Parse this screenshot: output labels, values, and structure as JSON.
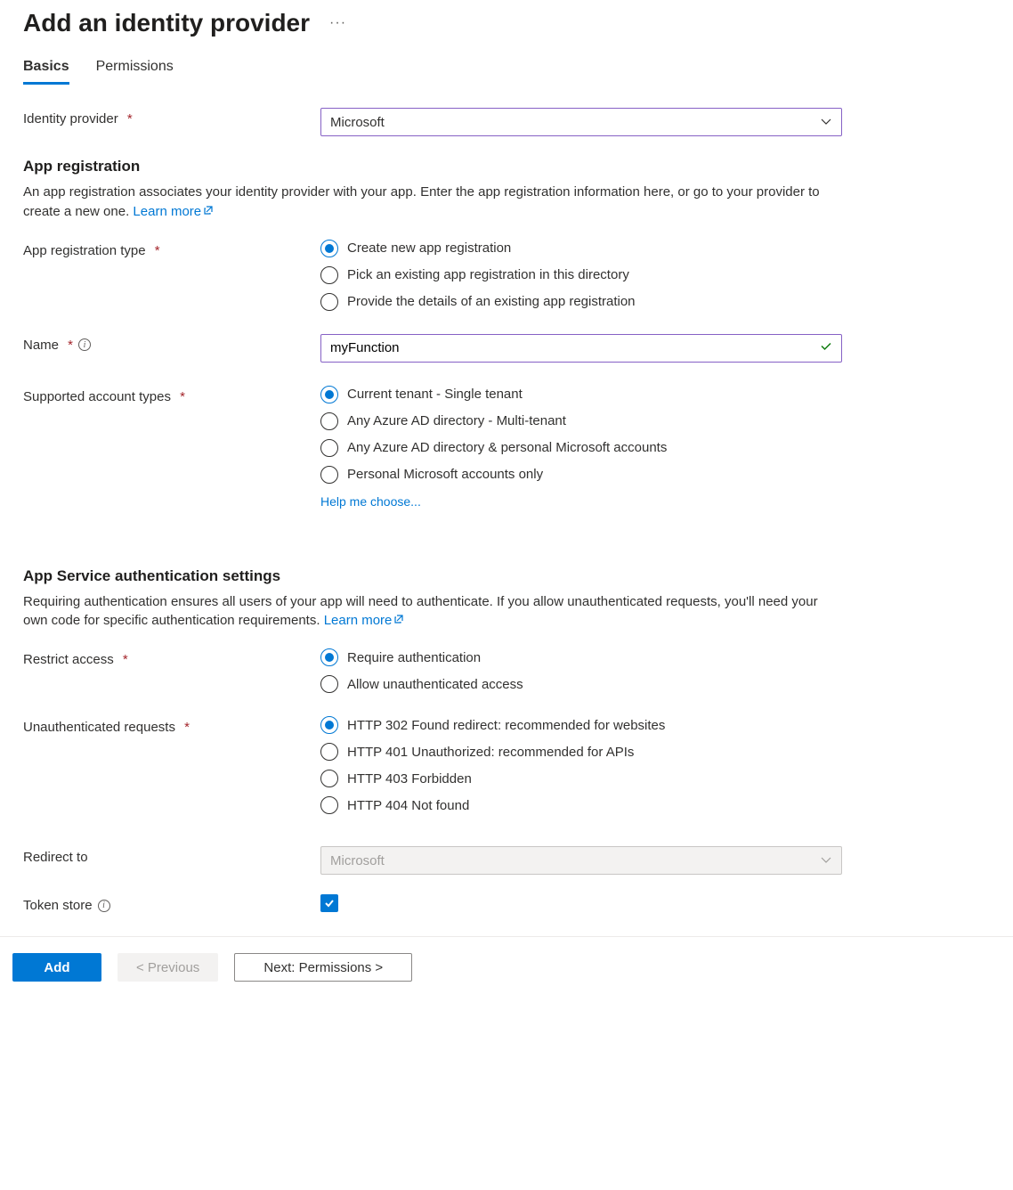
{
  "header": {
    "title": "Add an identity provider"
  },
  "tabs": {
    "basics": "Basics",
    "permissions": "Permissions"
  },
  "identity_provider": {
    "label": "Identity provider",
    "value": "Microsoft"
  },
  "app_reg": {
    "heading": "App registration",
    "desc_a": "An app registration associates your identity provider with your app. Enter the app registration information here, or go to your provider to create a new one. ",
    "learn_more": "Learn more",
    "type_label": "App registration type",
    "type_options": {
      "create": "Create new app registration",
      "pick": "Pick an existing app registration in this directory",
      "provide": "Provide the details of an existing app registration"
    },
    "name_label": "Name",
    "name_value": "myFunction",
    "supported_label": "Supported account types",
    "supported_options": {
      "single": "Current tenant - Single tenant",
      "multi": "Any Azure AD directory - Multi-tenant",
      "multi_personal": "Any Azure AD directory & personal Microsoft accounts",
      "personal": "Personal Microsoft accounts only"
    },
    "help_choose": "Help me choose..."
  },
  "auth_settings": {
    "heading": "App Service authentication settings",
    "desc_a": "Requiring authentication ensures all users of your app will need to authenticate. If you allow unauthenticated requests, you'll need your own code for specific authentication requirements. ",
    "learn_more": "Learn more",
    "restrict_label": "Restrict access",
    "restrict_options": {
      "require": "Require authentication",
      "allow": "Allow unauthenticated access"
    },
    "unauth_label": "Unauthenticated requests",
    "unauth_options": {
      "r302": "HTTP 302 Found redirect: recommended for websites",
      "r401": "HTTP 401 Unauthorized: recommended for APIs",
      "r403": "HTTP 403 Forbidden",
      "r404": "HTTP 404 Not found"
    },
    "redirect_label": "Redirect to",
    "redirect_value": "Microsoft",
    "token_store_label": "Token store"
  },
  "buttons": {
    "add": "Add",
    "previous": "< Previous",
    "next": "Next: Permissions >"
  }
}
